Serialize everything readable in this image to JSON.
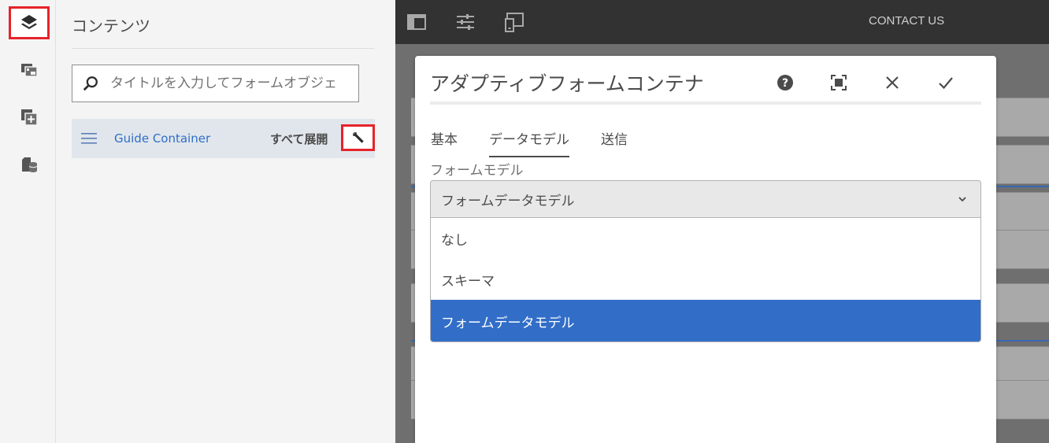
{
  "side_panel": {
    "title": "コンテンツ",
    "search_placeholder": "タイトルを入力してフォームオブジェ",
    "tree_item_label": "Guide Container",
    "expand_all_label": "すべて展開"
  },
  "editor": {
    "contact_label": "CONTACT US"
  },
  "dialog": {
    "title": "アダプティブフォームコンテナ",
    "tabs": [
      {
        "label": "基本"
      },
      {
        "label": "データモデル"
      },
      {
        "label": "送信"
      }
    ],
    "active_tab": "データモデル",
    "form_model_label": "フォームモデル",
    "form_model_value": "フォームデータモデル",
    "options": [
      {
        "label": "なし"
      },
      {
        "label": "スキーマ"
      },
      {
        "label": "フォームデータモデル"
      }
    ]
  },
  "colors": {
    "highlight_border": "#e6232a",
    "selected_option": "#326ec8",
    "link_text": "#2f6ec7",
    "topbar": "#323232"
  }
}
